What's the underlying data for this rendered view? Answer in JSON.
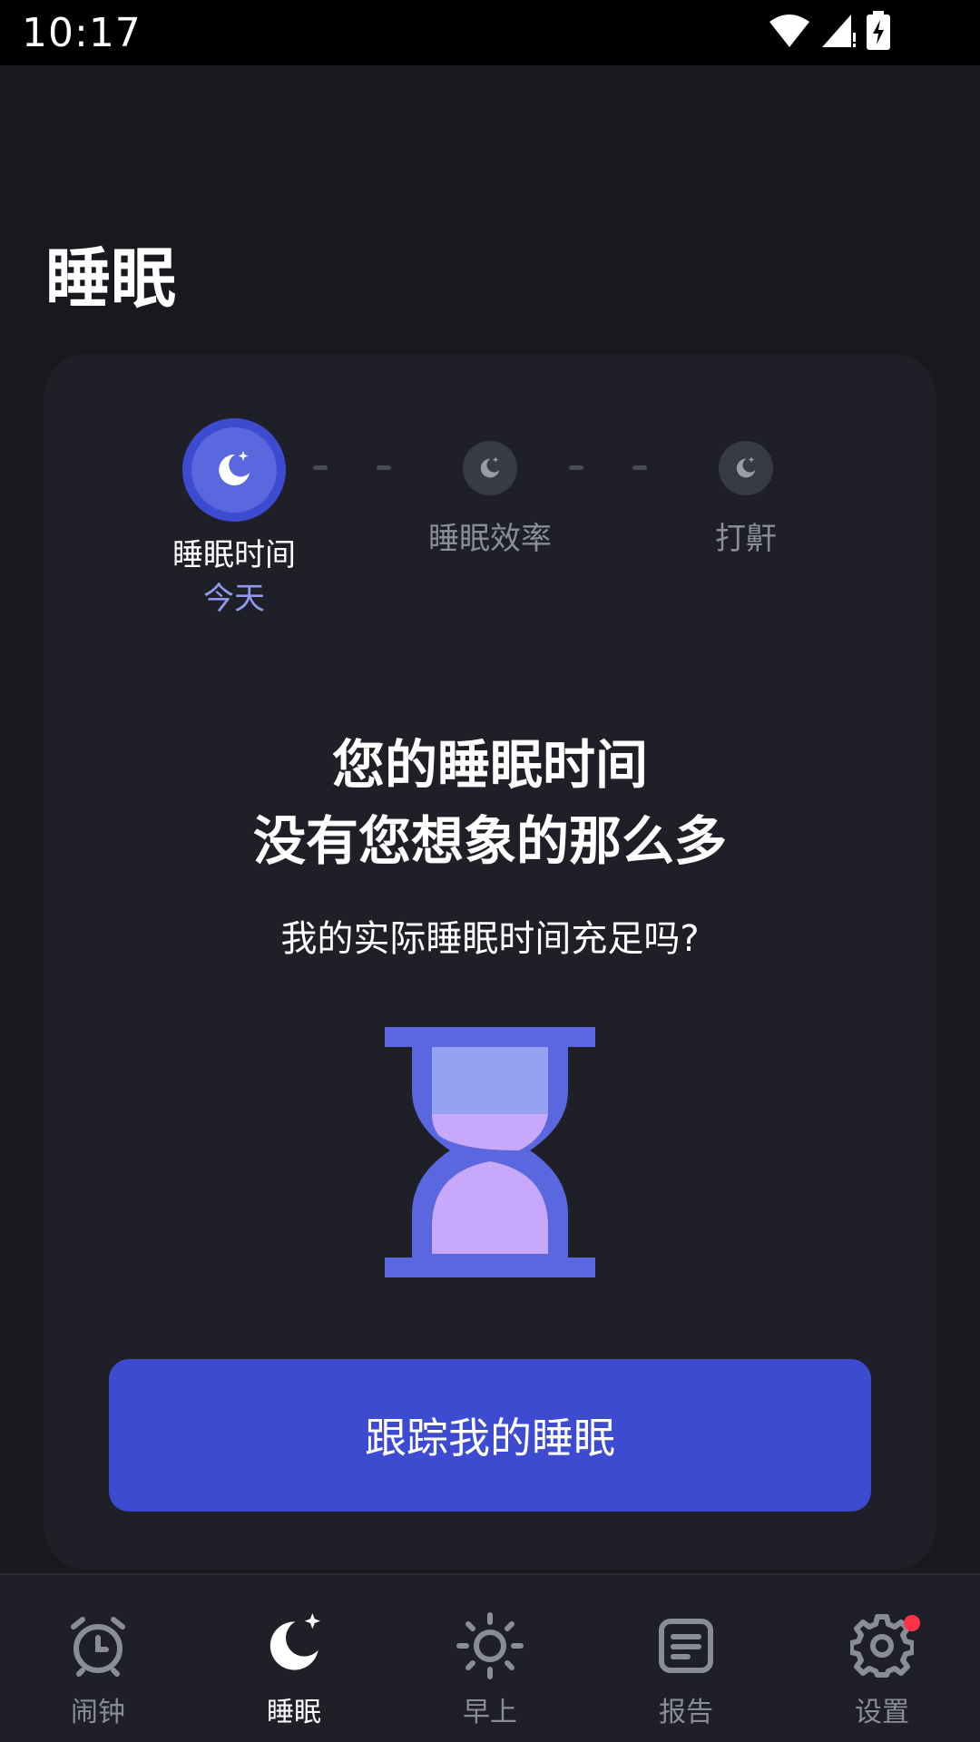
{
  "status_bar": {
    "time": "10:17",
    "icons": [
      "wifi-icon",
      "signal-icon",
      "battery-charging-icon"
    ]
  },
  "header": {
    "title": "睡眠"
  },
  "stepper": {
    "steps": [
      {
        "label": "睡眠时间",
        "sublabel": "今天",
        "active": true,
        "icon": "moon-star-icon"
      },
      {
        "label": "睡眠效率",
        "active": false,
        "icon": "moon-star-icon"
      },
      {
        "label": "打鼾",
        "active": false,
        "icon": "moon-star-icon"
      }
    ]
  },
  "main": {
    "headline_line1": "您的睡眠时间",
    "headline_line2": "没有您想象的那么多",
    "question": "我的实际睡眠时间充足吗?",
    "illustration": "hourglass-icon",
    "cta_label": "跟踪我的睡眠"
  },
  "bottom_nav": {
    "items": [
      {
        "label": "闹钟",
        "icon": "alarm-clock-icon",
        "active": false
      },
      {
        "label": "睡眠",
        "icon": "moon-star-icon",
        "active": true
      },
      {
        "label": "早上",
        "icon": "sun-icon",
        "active": false
      },
      {
        "label": "报告",
        "icon": "report-icon",
        "active": false
      },
      {
        "label": "设置",
        "icon": "gear-icon",
        "active": false,
        "badge": true
      }
    ]
  },
  "colors": {
    "background": "#18191f",
    "card": "#1f2027",
    "accent": "#3d4bd0",
    "accent_light": "#8f99f0",
    "badge": "#ff3347"
  }
}
